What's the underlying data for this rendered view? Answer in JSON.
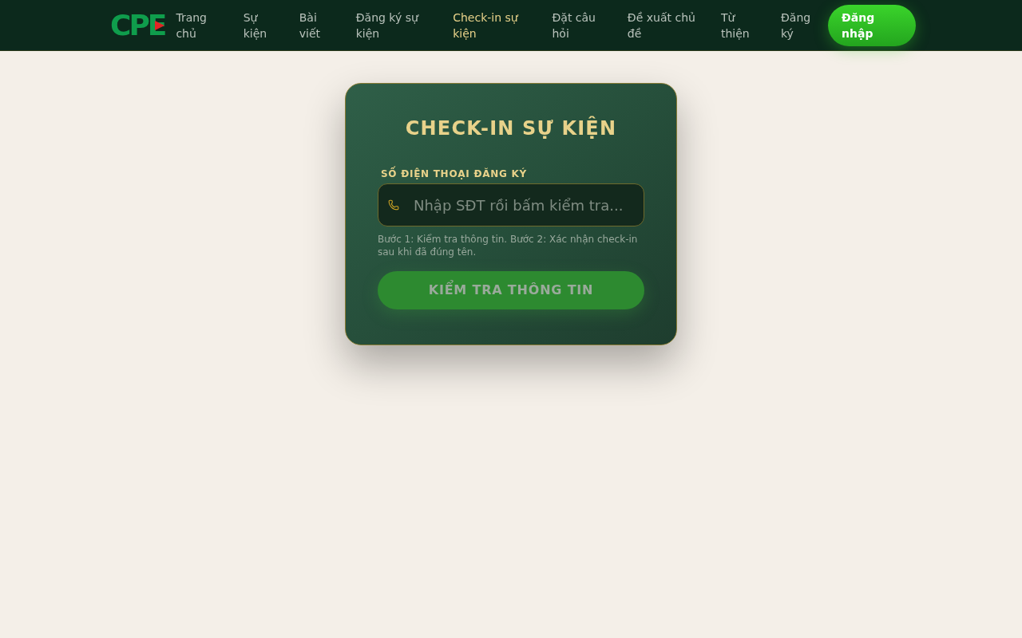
{
  "nav": {
    "logo": "CPE",
    "links": [
      {
        "label": "Trang chủ",
        "selected": false
      },
      {
        "label": "Sự kiện",
        "selected": false
      },
      {
        "label": "Bài viết",
        "selected": false
      },
      {
        "label": "Đăng ký sự kiện",
        "selected": false
      },
      {
        "label": "Check-in sự kiện",
        "selected": true
      },
      {
        "label": "Đặt câu hỏi",
        "selected": false
      },
      {
        "label": "Đề xuất chủ đề",
        "selected": false
      },
      {
        "label": "Từ thiện",
        "selected": false
      },
      {
        "label": "Đăng ký",
        "selected": false
      }
    ],
    "login": "Đăng nhập"
  },
  "card": {
    "title": "CHECK-IN SỰ KIỆN",
    "field": {
      "label": "SỐ ĐIỆN THOẠI ĐĂNG KÝ",
      "placeholder": "Nhập SĐT rồi bấm kiểm tra..."
    },
    "hint": "Bước 1: Kiểm tra thông tin. Bước 2: Xác nhận check-in sau khi đã đúng tên.",
    "button": {
      "label": "KIỂM TRA THÔNG TIN",
      "disabled": true
    }
  }
}
